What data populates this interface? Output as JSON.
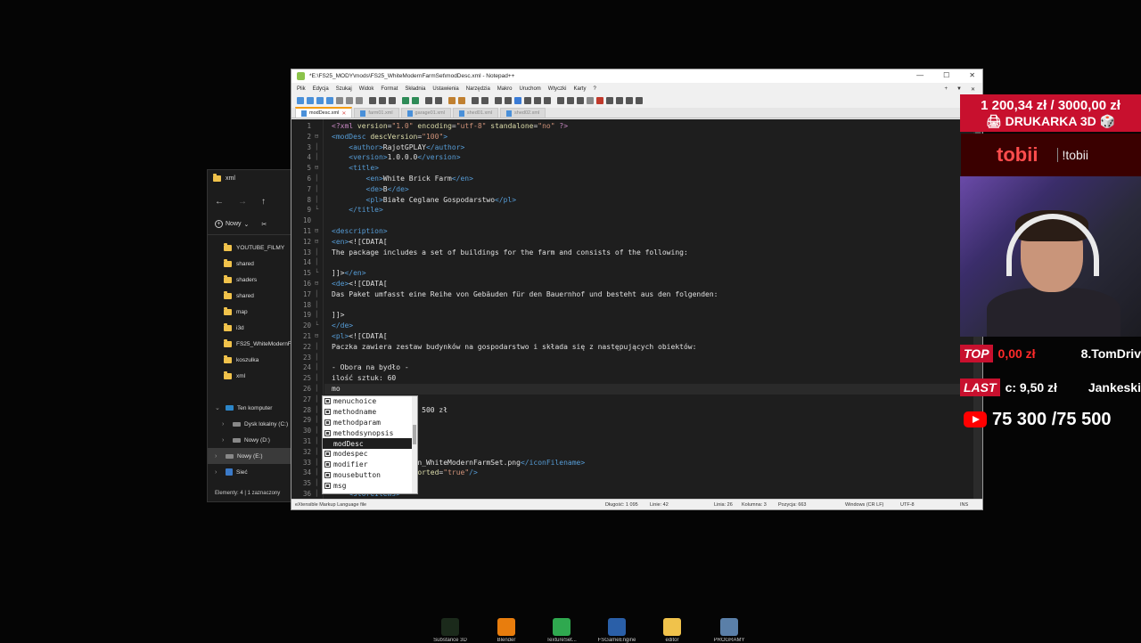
{
  "explorer": {
    "title": "xml",
    "nav": [
      "←",
      "→",
      "↑"
    ],
    "new_label": "Nowy",
    "folders": [
      "YOUTUBE_FILMY",
      "shared",
      "shaders",
      "shared",
      "map",
      "i3d",
      "FS25_WhiteModernF",
      "koszulka",
      "xml"
    ],
    "tree": [
      {
        "label": "Ten komputer",
        "chev": "⌄"
      },
      {
        "label": "Dysk lokalny (C:)",
        "chev": "›"
      },
      {
        "label": "Nowy (D:)",
        "chev": "›"
      },
      {
        "label": "Nowy (E:)",
        "chev": "›"
      },
      {
        "label": "Sieć",
        "chev": "›"
      }
    ],
    "status": "Elementy: 4  |  1 zaznaczony"
  },
  "npp": {
    "title": "*E:\\FS25_MODY\\mods\\FS25_WhiteModernFarmSet\\modDesc.xml - Notepad++",
    "menu": [
      "Plik",
      "Edycja",
      "Szukaj",
      "Widok",
      "Format",
      "Składnia",
      "Ustawienia",
      "Narzędzia",
      "Makro",
      "Uruchom",
      "Wtyczki",
      "Karty",
      "?"
    ],
    "menu_right": [
      "+",
      "▼",
      "✕"
    ],
    "tabs": [
      {
        "label": "modDesc.xml",
        "active": true
      },
      {
        "label": "farm01.xml",
        "active": false
      },
      {
        "label": "garage01.xml",
        "active": false
      },
      {
        "label": "shed01.xml",
        "active": false
      },
      {
        "label": "shed02.xml",
        "active": false
      }
    ],
    "lines": [
      {
        "n": 1,
        "fold": "",
        "html": "<span class='k-pi'>&lt;?xml</span> <span class='k-attr'>version</span>=<span class='k-val'>\"1.0\"</span> <span class='k-attr'>encoding</span>=<span class='k-val'>\"utf-8\"</span> <span class='k-attr'>standalone</span>=<span class='k-val'>\"no\"</span> <span class='k-pi'>?&gt;</span>"
      },
      {
        "n": 2,
        "fold": "⊟",
        "html": "<span class='k-tag'>&lt;modDesc</span> <span class='k-attr'>descVersion</span>=<span class='k-val'>\"100\"</span><span class='k-tag'>&gt;</span>"
      },
      {
        "n": 3,
        "fold": "│",
        "html": "    <span class='k-tag'>&lt;author&gt;</span>RajotGPLAY<span class='k-tag'>&lt;/author&gt;</span>"
      },
      {
        "n": 4,
        "fold": "│",
        "html": "    <span class='k-tag'>&lt;version&gt;</span>1.0.0.0<span class='k-tag'>&lt;/version&gt;</span>"
      },
      {
        "n": 5,
        "fold": "⊟",
        "html": "    <span class='k-tag'>&lt;title&gt;</span>"
      },
      {
        "n": 6,
        "fold": "│",
        "html": "        <span class='k-tag'>&lt;en&gt;</span>White Brick Farm<span class='k-tag'>&lt;/en&gt;</span>"
      },
      {
        "n": 7,
        "fold": "│",
        "html": "        <span class='k-tag'>&lt;de&gt;</span>B<span class='k-tag'>&lt;/de&gt;</span>"
      },
      {
        "n": 8,
        "fold": "│",
        "html": "        <span class='k-tag'>&lt;pl&gt;</span>Białe Ceglane Gospodarstwo<span class='k-tag'>&lt;/pl&gt;</span>"
      },
      {
        "n": 9,
        "fold": "└",
        "html": "    <span class='k-tag'>&lt;/title&gt;</span>"
      },
      {
        "n": 10,
        "fold": "",
        "html": ""
      },
      {
        "n": 11,
        "fold": "⊟",
        "html": "<span class='k-tag'>&lt;description&gt;</span>"
      },
      {
        "n": 12,
        "fold": "⊟",
        "html": "<span class='k-tag'>&lt;en&gt;</span>&lt;![CDATA["
      },
      {
        "n": 13,
        "fold": "│",
        "html": "The package includes a set of buildings for the farm and consists of the following:"
      },
      {
        "n": 14,
        "fold": "│",
        "html": ""
      },
      {
        "n": 15,
        "fold": "└",
        "html": "]]&gt;<span class='k-tag'>&lt;/en&gt;</span>"
      },
      {
        "n": 16,
        "fold": "⊟",
        "html": "<span class='k-tag'>&lt;de&gt;</span>&lt;![CDATA["
      },
      {
        "n": 17,
        "fold": "│",
        "html": "Das Paket umfasst eine Reihe von Gebäuden für den Bauernhof und besteht aus den folgenden:"
      },
      {
        "n": 18,
        "fold": "│",
        "html": ""
      },
      {
        "n": 19,
        "fold": "│",
        "html": "]]&gt;"
      },
      {
        "n": 20,
        "fold": "└",
        "html": "<span class='k-tag'>&lt;/de&gt;</span>"
      },
      {
        "n": 21,
        "fold": "⊟",
        "html": "<span class='k-tag'>&lt;pl&gt;</span>&lt;![CDATA["
      },
      {
        "n": 22,
        "fold": "│",
        "html": "Paczka zawiera zestaw budynków na gospodarstwo i składa się z następujących obiektów:"
      },
      {
        "n": 23,
        "fold": "│",
        "html": ""
      },
      {
        "n": 24,
        "fold": "│",
        "html": "- Obora na bydło -"
      },
      {
        "n": 25,
        "fold": "│",
        "html": "ilość sztuk: 60"
      },
      {
        "n": 26,
        "fold": "│",
        "html": "mo",
        "cur": true
      },
      {
        "n": 27,
        "fold": "│",
        "html": ""
      },
      {
        "n": 28,
        "fold": "│",
        "html": "                  e: 500 zł"
      },
      {
        "n": 29,
        "fold": "│",
        "html": ""
      },
      {
        "n": 30,
        "fold": "│",
        "html": ""
      },
      {
        "n": 31,
        "fold": "│",
        "html": ""
      },
      {
        "n": 32,
        "fold": "│",
        "html": ""
      },
      {
        "n": 33,
        "fold": "│",
        "html": "                <span class='k-tag'>&gt;</span>icon_WhiteModernFarmSet.png<span class='k-tag'>&lt;/iconFilename&gt;</span>"
      },
      {
        "n": 34,
        "fold": "│",
        "html": "                <span class='k-attr'>supported</span>=<span class='k-val'>\"true\"</span><span class='k-tag'>/&gt;</span>"
      },
      {
        "n": 35,
        "fold": "│",
        "html": ""
      },
      {
        "n": 36,
        "fold": "│",
        "html": "    <span class='k-tag'>&lt;storeItems&gt;</span>"
      }
    ],
    "autocomplete": [
      {
        "label": "menuchoice",
        "icon": true
      },
      {
        "label": "methodname",
        "icon": true
      },
      {
        "label": "methodparam",
        "icon": true
      },
      {
        "label": "methodsynopsis",
        "icon": true
      },
      {
        "label": "modDesc",
        "icon": false,
        "sel": true
      },
      {
        "label": "modespec",
        "icon": true
      },
      {
        "label": "modifier",
        "icon": true
      },
      {
        "label": "mousebutton",
        "icon": true
      },
      {
        "label": "msg",
        "icon": true
      }
    ],
    "status": {
      "lang": "eXtensible Markup Language file",
      "length": "Długość: 1 095",
      "lines": "Linie: 42",
      "row": "Linia: 26",
      "col": "Kolumna: 3",
      "pos": "Pozycja: 663",
      "eol": "Windows (CR LF)",
      "enc": "UTF-8",
      "ins": "INS"
    }
  },
  "overlay": {
    "donation_amount": "1 200,34 zł / 3000,00 zł",
    "donation_goal": "🖨 DRUKARKA 3D 🎲",
    "tobii_logo": "tobii",
    "tobii_cmd": "!tobii",
    "top_tag": "TOP",
    "top_amount": "0,00 zł",
    "top_name": "8.TomDriv",
    "last_tag": "LAST",
    "last_amount": "c: 9,50 zł",
    "last_name": "Jankeski",
    "yt_count": "75 300 /75 500"
  },
  "taskbar": [
    {
      "label": "Substance 3D",
      "color": "#1b2a1b"
    },
    {
      "label": "Blender",
      "color": "#e87d0d"
    },
    {
      "label": "TextureSet...",
      "color": "#2fa84f"
    },
    {
      "label": "FSGameEngine",
      "color": "#2a5fa8"
    },
    {
      "label": "editor",
      "color": "#f0c24b"
    },
    {
      "label": "PROGRAMY",
      "color": "#5a7fa8"
    }
  ],
  "colors": {
    "editor_bg": "#1e1e1e",
    "tag": "#569cd6",
    "attr": "#dcdcaa",
    "value": "#ce9178",
    "overlay_red": "#c8102e"
  }
}
